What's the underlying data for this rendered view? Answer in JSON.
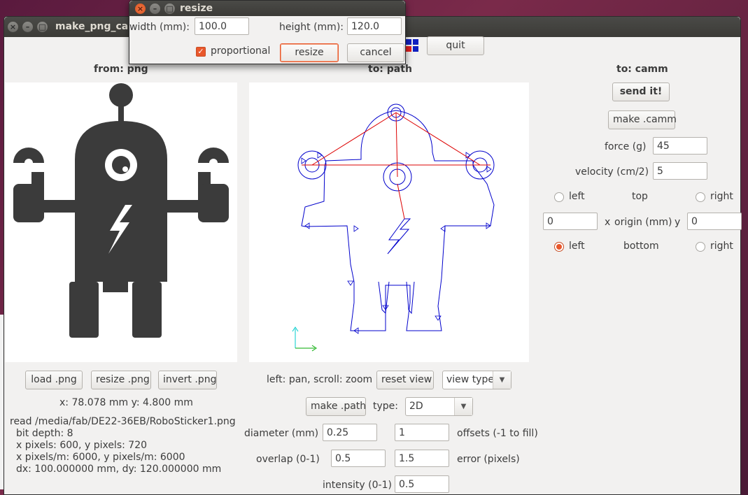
{
  "main_window": {
    "title": "make_png_cam",
    "quit_label": "quit",
    "sections": {
      "from": "from: png",
      "to_path": "to: path",
      "to_camm": "to: camm"
    }
  },
  "png_panel": {
    "buttons": {
      "load": "load .png",
      "resize": "resize .png",
      "invert": "invert .png"
    },
    "coords": "x: 78.078 mm  y: 4.800 mm",
    "info_lines": [
      "read /media/fab/DE22-36EB/RoboSticker1.png",
      "bit depth: 8",
      "x pixels: 600, y pixels: 720",
      "x pixels/m: 6000, y pixels/m: 6000",
      "dx: 100.000000 mm, dy: 120.000000 mm"
    ]
  },
  "path_panel": {
    "hint": "left: pan, scroll: zoom",
    "reset_view": "reset view",
    "view_type": "view type",
    "make_path": "make .path",
    "type_label": "type:",
    "type_value": "2D",
    "diameter_label": "diameter (mm)",
    "diameter_value": "0.25",
    "offsets_value": "1",
    "offsets_label": "offsets (-1 to fill)",
    "overlap_label": "overlap (0-1)",
    "overlap_value": "0.5",
    "error_value": "1.5",
    "error_label": "error (pixels)",
    "intensity_label": "intensity (0-1)",
    "intensity_value": "0.5"
  },
  "camm_panel": {
    "send": "send it!",
    "make_camm": "make .camm",
    "force_label": "force (g)",
    "force_value": "45",
    "velocity_label": "velocity (cm/2)",
    "velocity_value": "5",
    "top_row": {
      "left": "left",
      "center": "top",
      "right": "right",
      "selected": "none"
    },
    "origin_x": "0",
    "origin_label_x": "x",
    "origin_label": "origin (mm)",
    "origin_label_y": "y",
    "origin_y": "0",
    "bottom_row": {
      "left": "left",
      "center": "bottom",
      "right": "right",
      "selected": "left"
    }
  },
  "resize_dialog": {
    "title": "resize",
    "width_label": "width (mm):",
    "width_value": "100.0",
    "height_label": "height (mm):",
    "height_value": "120.0",
    "proportional_label": "proportional",
    "proportional_checked": true,
    "resize_button": "resize",
    "cancel_button": "cancel"
  },
  "colors": {
    "robot": "#3b3b3b",
    "path_stroke": "#0000cc",
    "path_links": "#dd0000",
    "accent": "#e9572b"
  }
}
